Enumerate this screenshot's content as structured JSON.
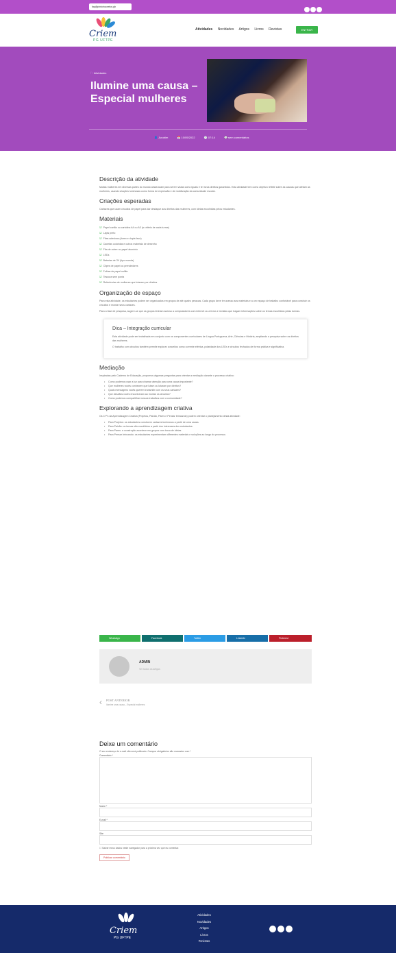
{
  "topbar": {
    "email": "faq@pintoincoretos.gh"
  },
  "header": {
    "logo_word": "Criem",
    "logo_sub": "PG UFTPE",
    "nav": [
      "Atividades",
      "Novidades",
      "Artigos",
      "Livros",
      "Revistas"
    ],
    "cta": "ENTRAR"
  },
  "hero": {
    "category": "Atividades",
    "title": "Ilumine uma causa – Especial mulheres",
    "meta": [
      "Jurubim",
      "10/05/2022",
      "07:14",
      "sem comentários"
    ]
  },
  "content": {
    "h_desc": "Descrição da atividade",
    "p_desc": "Muitas mulheres em diversas partes do mundo ainda lutam para serem vistas como iguais e ter seus direitos garantidos. Esta atividade tem como objetivo refletir sobre as causas que afetam as mulheres, usando criações luminosas como forma de expressão e de mobilização da comunidade escolar.",
    "h_criacoes": "Criações esperadas",
    "p_criacoes": "Cartazes que usam circuitos de papel para dar destaque aos direitos das mulheres, com ideias escolhidas pelos estudantes.",
    "h_materiais": "Materiais",
    "materiais": [
      "Papel cartão ou cartolina A4 ou A3 (a critério de cada turma)",
      "Lápis preto",
      "Fitas adesivas (durex e dupla face)",
      "Canetas coloridas e outros materiais de desenho",
      "Fita de cobre ou papel alumínio",
      "LEDs",
      "Baterias de 3V (tipo moeda)",
      "Clipes de papel ou prendedores",
      "Folhas de papel sulfite",
      "Tesoura sem ponta",
      "Referências de mulheres que lutaram por direitos"
    ],
    "h_org": "Organização de espaço",
    "p_org1": "Para esta atividade, os estudantes podem ser organizados em grupos de até quatro pessoas. Cada grupo deve ter acesso aos materiais e a um espaço de trabalho confortável para construir os circuitos e montar seus cartazes.",
    "p_org2": "Para a fase de pesquisa, sugere-se que os grupos tenham acesso a computadores com internet ou a livros e revistas que tragam informações sobre os temas escolhidos pelas turmas.",
    "dica_title": "Dica – Integração curricular",
    "dica_p1": "Esta atividade pode ser trabalhada em conjunto com os componentes curriculares de Língua Portuguesa, Arte, Ciências e História, ampliando a pesquisa sobre os direitos das mulheres.",
    "dica_p2": "O trabalho com circuitos também permite explorar conceitos como corrente elétrica, polaridade dos LEDs e circuitos fechados de forma prática e significativa.",
    "h_mediacao": "Mediação",
    "p_mediacao": "Inspiradas pelo Caderno de Educação, propomos algumas perguntas para orientar a mediação durante o processo criativo:",
    "mediacao": [
      "Como podemos usar a luz para chamar atenção para uma causa importante?",
      "Que mulheres vocês conhecem que lutam ou lutaram por direitos?",
      "Quais mensagens vocês querem transmitir com os seus cartazes?",
      "Que desafios vocês encontraram ao montar os circuitos?",
      "Como podemos compartilhar nossos trabalhos com a comunidade?"
    ],
    "h_explorando": "Explorando a aprendizagem criativa",
    "p_explorando": "Os 4 P's da Aprendizagem Criativa (Projetos, Paixão, Pares e Pensar brincando) podem orientar o planejamento desta atividade:",
    "explorando": [
      "Para Projetos: os estudantes constroem cartazes luminosos a partir de uma causa.",
      "Para Paixão: os temas são escolhidos a partir dos interesses dos estudantes.",
      "Para Pares: a construção acontece em grupos com troca de ideias.",
      "Para Pensar brincando: os estudantes experimentam diferentes materiais e soluções ao longo do processo."
    ]
  },
  "share": [
    "WhatsApp",
    "Facebook",
    "Twitter",
    "LinkedIn",
    "Pinterest"
  ],
  "author": {
    "name": "ADMIN",
    "sub": "Ver todos os artigos"
  },
  "prev": {
    "label": "POST ANTERIOR",
    "title": "Ilumine uma causa – Especial mulheres"
  },
  "comment": {
    "title": "Deixe um comentário",
    "note": "O seu endereço de e-mail não será publicado. Campos obrigatórios são marcados com *",
    "label_comment": "Comentário *",
    "label_name": "Nome *",
    "label_email": "E-mail *",
    "label_site": "Site",
    "checkbox": "Salvar meus dados neste navegador para a próxima vez que eu comentar.",
    "submit": "Publicar comentário"
  },
  "footer": {
    "logo_word": "Criem",
    "logo_sub": "PG UFTPE",
    "links": [
      "Atividades",
      "Novidades",
      "Artigos",
      "Livros",
      "Revistas"
    ]
  },
  "colors": {
    "topbar": "#b24fc9",
    "hero": "#a24bbd",
    "accent": "#3ab54a",
    "footer": "#152a6a",
    "whatsapp": "#3ab54a",
    "facebook": "#0f6f6e",
    "twitter": "#2b9ce5",
    "linkedin": "#176ea8",
    "pinterest": "#bb1f2b"
  }
}
